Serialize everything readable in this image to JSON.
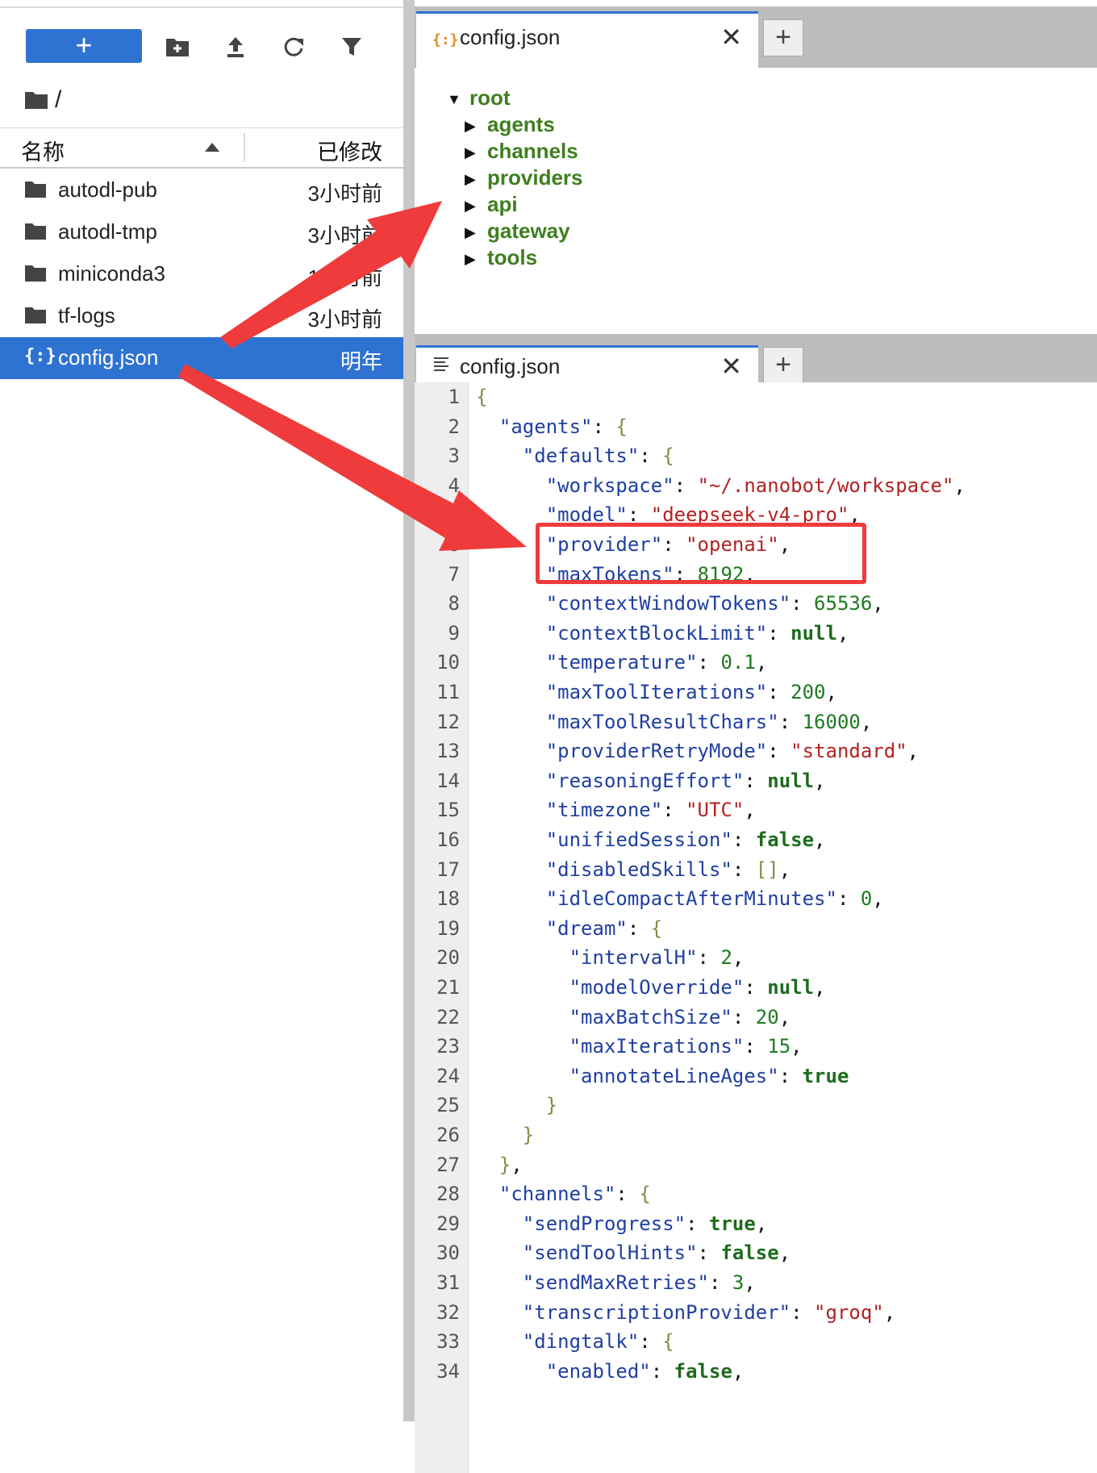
{
  "toolbar": {
    "new_label": "+",
    "icons": [
      "new-folder-icon",
      "upload-icon",
      "refresh-icon",
      "filter-icon"
    ]
  },
  "breadcrumb": "/",
  "file_list": {
    "col_name": "名称",
    "col_modified": "已修改",
    "rows": [
      {
        "name": "autodl-pub",
        "modified": "3小时前",
        "type": "folder"
      },
      {
        "name": "autodl-tmp",
        "modified": "3小时前",
        "type": "folder"
      },
      {
        "name": "miniconda3",
        "modified": "1个月前",
        "type": "folder"
      },
      {
        "name": "tf-logs",
        "modified": "3小时前",
        "type": "folder"
      },
      {
        "name": "config.json",
        "modified": "明年",
        "type": "json",
        "selected": true
      }
    ]
  },
  "json_viewer_tab": {
    "title": "config.json",
    "close": "✕",
    "add": "+"
  },
  "tree": {
    "root_label": "root",
    "children": [
      "agents",
      "channels",
      "providers",
      "api",
      "gateway",
      "tools"
    ]
  },
  "editor_tab": {
    "title": "config.json",
    "close": "✕",
    "add": "+"
  },
  "editor": {
    "line_numbers": [
      "1",
      "2",
      "3",
      "4",
      "5",
      "6",
      "7",
      "8",
      "9",
      "10",
      "11",
      "12",
      "13",
      "14",
      "15",
      "16",
      "17",
      "18",
      "19",
      "20",
      "21",
      "22",
      "23",
      "24",
      "25",
      "26",
      "27",
      "28",
      "29",
      "30",
      "31",
      "32",
      "33",
      "34"
    ],
    "lines": [
      "{",
      "  \"agents\": {",
      "    \"defaults\": {",
      "      \"workspace\": \"~/.nanobot/workspace\",",
      "      \"model\": \"deepseek-v4-pro\",",
      "      \"provider\": \"openai\",",
      "      \"maxTokens\": 8192,",
      "      \"contextWindowTokens\": 65536,",
      "      \"contextBlockLimit\": null,",
      "      \"temperature\": 0.1,",
      "      \"maxToolIterations\": 200,",
      "      \"maxToolResultChars\": 16000,",
      "      \"providerRetryMode\": \"standard\",",
      "      \"reasoningEffort\": null,",
      "      \"timezone\": \"UTC\",",
      "      \"unifiedSession\": false,",
      "      \"disabledSkills\": [],",
      "      \"idleCompactAfterMinutes\": 0,",
      "      \"dream\": {",
      "        \"intervalH\": 2,",
      "        \"modelOverride\": null,",
      "        \"maxBatchSize\": 20,",
      "        \"maxIterations\": 15,",
      "        \"annotateLineAges\": true",
      "      }",
      "    }",
      "  },",
      "  \"channels\": {",
      "    \"sendProgress\": true,",
      "    \"sendToolHints\": false,",
      "    \"sendMaxRetries\": 3,",
      "    \"transcriptionProvider\": \"groq\",",
      "    \"dingtalk\": {",
      "      \"enabled\": false,"
    ]
  },
  "colors": {
    "accent": "#2f73d2",
    "annotation_red": "#ef3b3b",
    "json_key": "#1f3fa0",
    "json_string": "#b22222",
    "json_number": "#1d7a1d",
    "tree_label": "#3f7f1f"
  }
}
